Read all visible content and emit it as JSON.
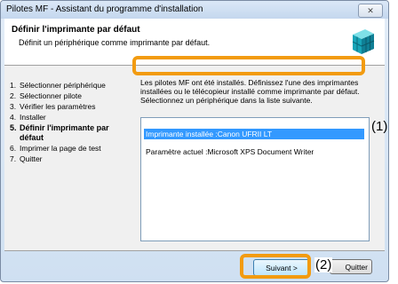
{
  "window": {
    "title": "Pilotes MF - Assistant du programme d'installation",
    "close_icon": "close-x-icon"
  },
  "header": {
    "title": "Définir l'imprimante par défaut",
    "subtitle": "Définit un périphérique comme imprimante par défaut.",
    "icon": "install-cube-icon"
  },
  "steps": [
    {
      "num": "1.",
      "label": "Sélectionner périphérique",
      "active": false
    },
    {
      "num": "2.",
      "label": "Sélectionner pilote",
      "active": false
    },
    {
      "num": "3.",
      "label": "Vérifier les paramètres",
      "active": false
    },
    {
      "num": "4.",
      "label": "Installer",
      "active": false
    },
    {
      "num": "5.",
      "label": "Définir l'imprimante par défaut",
      "active": true
    },
    {
      "num": "6.",
      "label": "Imprimer la page de test",
      "active": false
    },
    {
      "num": "7.",
      "label": "Quitter",
      "active": false
    }
  ],
  "content": {
    "info": "Les pilotes MF ont été installés. Définissez l'une des imprimantes installées ou le télécopieur installé comme imprimante par défaut. Sélectionnez un périphérique dans la liste suivante.",
    "selected_item": "Imprimante installée :Canon                    UFRII LT",
    "current_setting": "Paramètre actuel :Microsoft XPS Document Writer"
  },
  "buttons": {
    "next": "Suivant >",
    "quit": "Quitter"
  },
  "callouts": {
    "one": "(1)",
    "two": "(2)"
  },
  "colors": {
    "highlight": "#f29b10",
    "selection": "#3399ff"
  }
}
